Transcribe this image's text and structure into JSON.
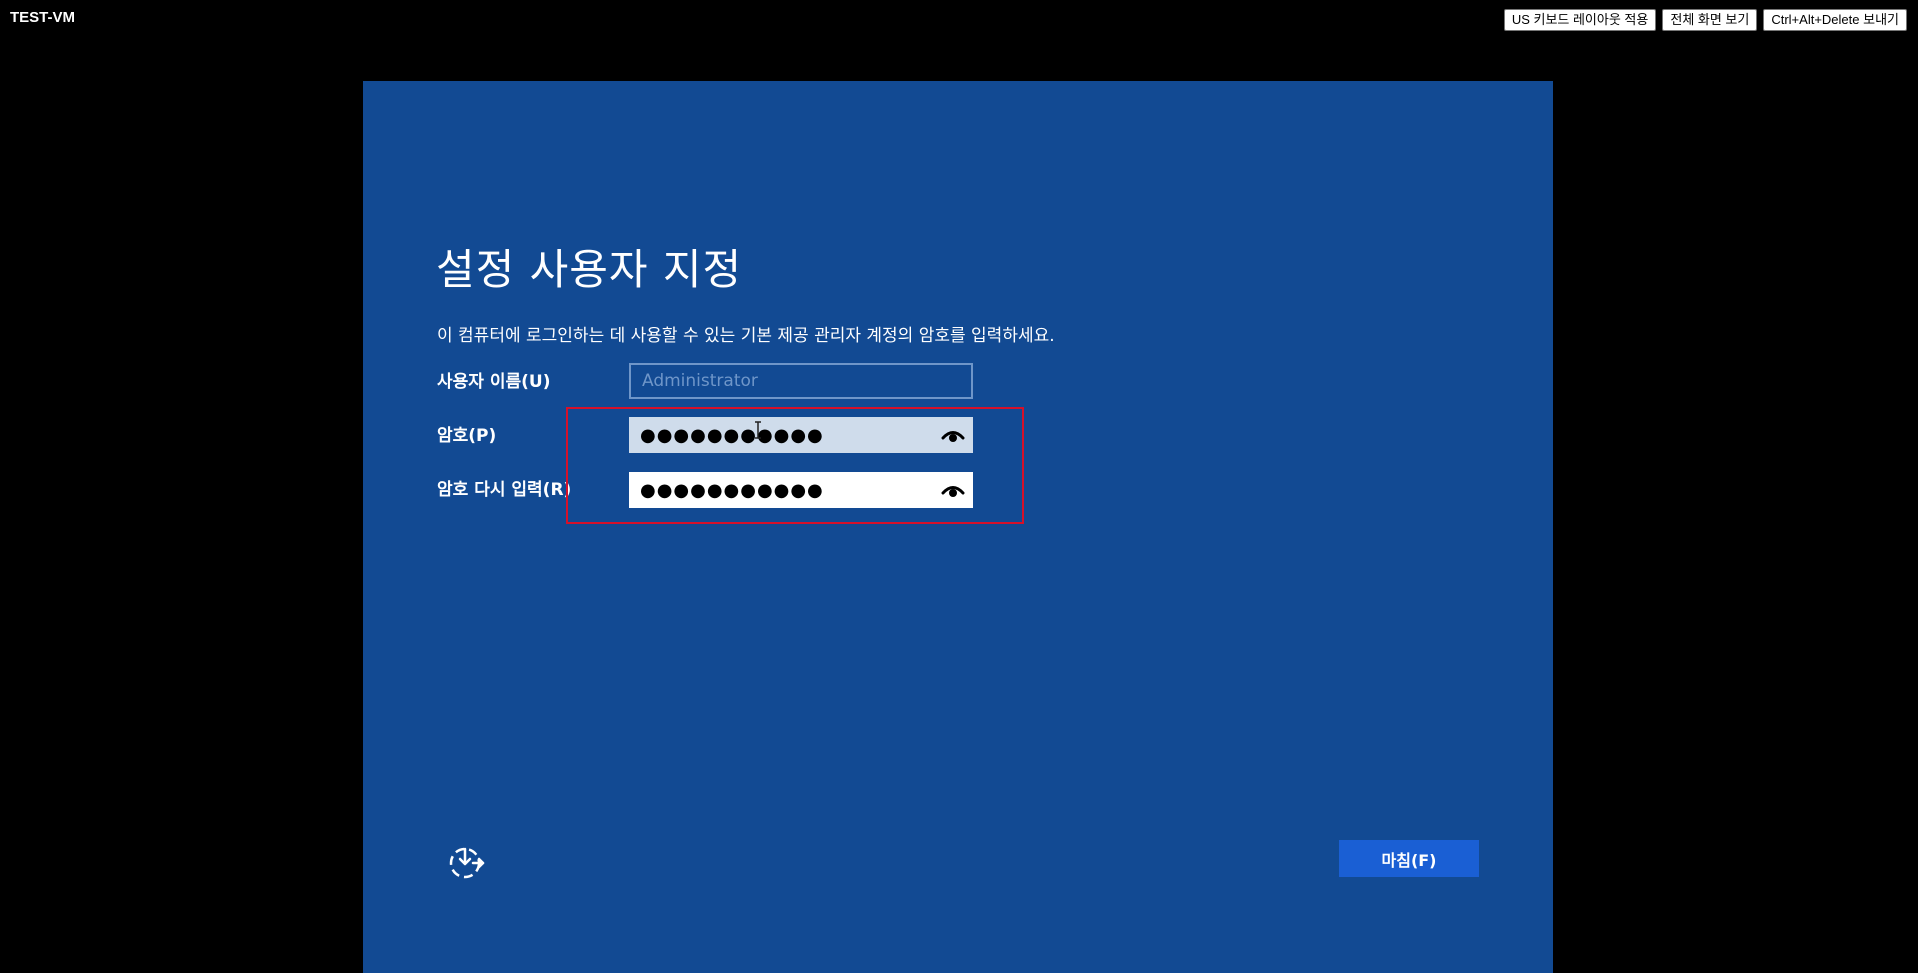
{
  "vm": {
    "title": "TEST-VM"
  },
  "toolbar": {
    "buttons": [
      {
        "label": "US 키보드 레이아웃 적용"
      },
      {
        "label": "전체 화면 보기"
      },
      {
        "label": "Ctrl+Alt+Delete 보내기"
      }
    ]
  },
  "setup": {
    "heading": "설정 사용자 지정",
    "description": "이 컴퓨터에 로그인하는 데 사용할 수 있는 기본 제공 관리자 계정의 암호를 입력하세요.",
    "username": {
      "label": "사용자 이름(U)",
      "placeholder": "Administrator"
    },
    "password": {
      "label": "암호(P)",
      "value": "●●●●●●●●●●●"
    },
    "password_confirm": {
      "label": "암호 다시 입력(R)",
      "value": "●●●●●●●●●●●"
    },
    "finish_label": "마침(F)"
  },
  "icons": {
    "reveal": "eye-icon",
    "accessibility": "ease-of-access-icon"
  },
  "colors": {
    "background": "#124a93",
    "highlight": "#d5112a",
    "finish_button": "#1a5fd4"
  }
}
